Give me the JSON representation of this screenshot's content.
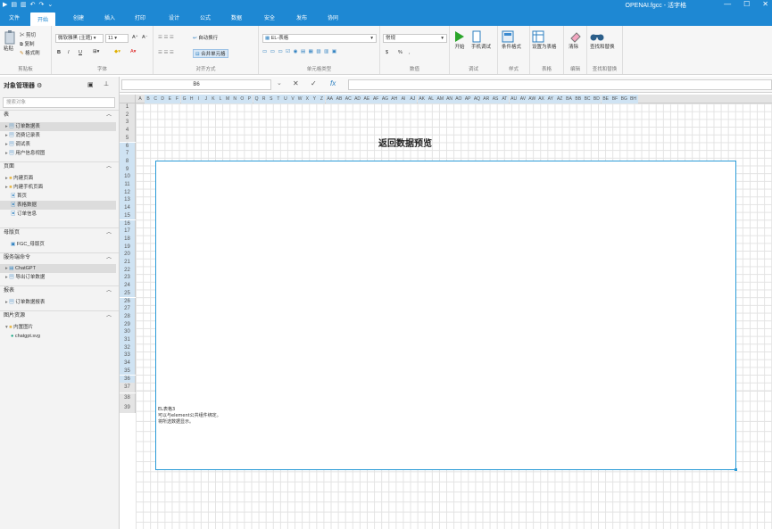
{
  "window": {
    "title": "OPENAI.fgcc - 活字格",
    "quick_access": [
      "▶",
      "▤",
      "▥",
      "↶",
      "↷",
      "⌄"
    ],
    "controls": [
      "—",
      "☐",
      "✕"
    ]
  },
  "tabs": [
    {
      "label": "文件"
    },
    {
      "label": "开始"
    },
    {
      "label": "创建"
    },
    {
      "label": "插入"
    },
    {
      "label": "打印"
    },
    {
      "label": "设计"
    },
    {
      "label": "公式"
    },
    {
      "label": "数据"
    },
    {
      "label": "安全"
    },
    {
      "label": "发布"
    },
    {
      "label": "协同"
    }
  ],
  "ribbon": {
    "clipboard": {
      "paste": "粘贴",
      "cut": "剪切",
      "copy": "复制",
      "format_painter": "格式刷",
      "label": "剪贴板"
    },
    "font": {
      "family": "微软雅黑 (主题)",
      "size": "11",
      "grow": "A⁺",
      "shrink": "A⁻",
      "bold": "B",
      "italic": "I",
      "underline": "U",
      "label": "字体"
    },
    "alignment": {
      "wrap": "自动换行",
      "merge": "合并单元格",
      "label": "对齐方式"
    },
    "celltype": {
      "value": "EL-表格",
      "label": "单元格类型"
    },
    "number": {
      "value": "常规",
      "currency": "$",
      "percent": "%",
      "comma": ",",
      "label": "数值"
    },
    "debug": {
      "start": "开始",
      "mobile": "手机调试",
      "label": "调试"
    },
    "style": {
      "cond": "条件格式",
      "label": "样式"
    },
    "table": {
      "set": "设置为表格",
      "label": "表格"
    },
    "edit": {
      "clear": "清除",
      "label": "编辑"
    },
    "find": {
      "find": "查找和替换",
      "label": "查找和替换"
    }
  },
  "panel": {
    "title": "对象管理器",
    "search_placeholder": "搜索对象",
    "sections": [
      {
        "name": "表",
        "items": [
          "订单数据表",
          "消费记录表",
          "调试表",
          "用户信息视图"
        ]
      },
      {
        "name": "页面",
        "items": [
          "内建页面",
          "内建手机页面",
          "首页",
          "表格数据",
          "订单信息"
        ]
      },
      {
        "name": "母版页",
        "items": [
          "FGC_母版页"
        ]
      },
      {
        "name": "服务端命令",
        "items": [
          "ChatGPT",
          "导出订单数据"
        ]
      },
      {
        "name": "报表",
        "items": [
          "订单数据报表"
        ]
      },
      {
        "name": "图片资源",
        "items": [
          "内置图片",
          "chatgpt.svg"
        ]
      }
    ]
  },
  "formula": {
    "cell": "B6",
    "cancel": "✕",
    "ok": "✓",
    "fx": "fx"
  },
  "sheet": {
    "columns": [
      "A",
      "B",
      "C",
      "D",
      "E",
      "F",
      "G",
      "H",
      "I",
      "J",
      "K",
      "L",
      "M",
      "N",
      "O",
      "P",
      "Q",
      "R",
      "S",
      "T",
      "U",
      "V",
      "W",
      "X",
      "Y",
      "Z",
      "AA",
      "AB",
      "AC",
      "AD",
      "AE",
      "AF",
      "AG",
      "AH",
      "AI",
      "AJ",
      "AK",
      "AL",
      "AM",
      "AN",
      "AO",
      "AP",
      "AQ",
      "AR",
      "AS",
      "AT",
      "AU",
      "AV",
      "AW",
      "AX",
      "AY",
      "AZ",
      "BA",
      "BB",
      "BC",
      "BD",
      "BE",
      "BF",
      "BG",
      "BH"
    ],
    "rows": [
      "1",
      "2",
      "3",
      "4",
      "5",
      "6",
      "7",
      "8",
      "9",
      "10",
      "11",
      "12",
      "13",
      "14",
      "15",
      "16",
      "17",
      "18",
      "19",
      "20",
      "21",
      "22",
      "23",
      "24",
      "25",
      "26",
      "27",
      "28",
      "29",
      "30",
      "31",
      "32",
      "33",
      "34",
      "35",
      "36",
      "37",
      "38",
      "39"
    ],
    "title": "返回数据预览",
    "notes": [
      "EL表格3",
      "可以与element公共组件绑定。",
      "将所选数据显示。"
    ]
  }
}
